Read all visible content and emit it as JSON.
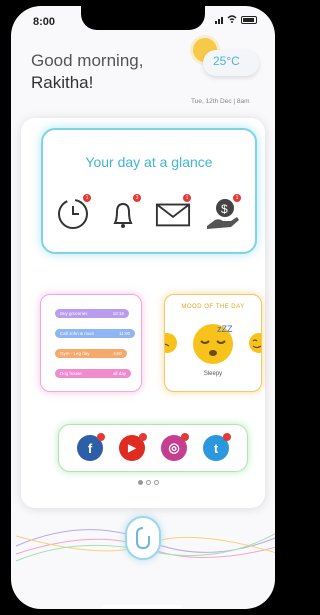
{
  "status_bar": {
    "time": "8:00"
  },
  "greeting": {
    "line1": "Good morning,",
    "line2": "Rakitha!"
  },
  "weather": {
    "temperature": "25°C",
    "icon": "sun-cloud-icon"
  },
  "date_time": "Tue, 12th Dec | 8am",
  "glance_card": {
    "title": "Your day at a glance",
    "icons": [
      {
        "name": "clock-icon",
        "badge": "1"
      },
      {
        "name": "bell-icon",
        "badge": "3"
      },
      {
        "name": "mail-icon",
        "badge": "1"
      },
      {
        "name": "money-hand-icon",
        "badge": "1"
      }
    ]
  },
  "tasks_card": {
    "tasks": [
      {
        "label": "Buy groceries",
        "time": "10:15",
        "color": "#b99cf0"
      },
      {
        "label": "Call John & mum",
        "time": "11:00",
        "color": "#8fb6f2"
      },
      {
        "label": "Gym - Leg day",
        "time": "4:00",
        "color": "#f7a86b"
      },
      {
        "label": "Dog house",
        "time": "all day",
        "color": "#f08bd0"
      }
    ]
  },
  "mood_card": {
    "title": "MOOD OF THE DAY",
    "selected": "Sleepy",
    "sleep_text": "zZZ"
  },
  "social_card": {
    "items": [
      {
        "name": "facebook-icon",
        "glyph": "f",
        "color": "#2d5fa8"
      },
      {
        "name": "youtube-icon",
        "glyph": "▶",
        "color": "#e02b20"
      },
      {
        "name": "instagram-icon",
        "glyph": "◎",
        "color": "#c53e8f"
      },
      {
        "name": "twitter-icon",
        "glyph": "t",
        "color": "#2b97dc"
      }
    ]
  },
  "pagination": {
    "pages": 3,
    "active": 1
  }
}
